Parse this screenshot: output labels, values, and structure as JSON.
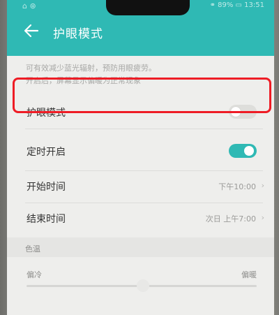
{
  "status": {
    "left": "⌂ ⊛",
    "right": "⚭ 89% ▭ 13:51"
  },
  "header": {
    "title": "护眼模式",
    "back_icon": "back-arrow-icon",
    "color": "#2fb9b4"
  },
  "description": {
    "line1": "可有效减少蓝光辐射，预防用眼疲劳。",
    "line2": "开启后，屏幕显示偏暖为正常现象"
  },
  "settings": {
    "eye_mode": {
      "label": "护眼模式",
      "enabled": false
    },
    "scheduled": {
      "label": "定时开启",
      "enabled": true
    },
    "start_time": {
      "label": "开始时间",
      "value": "下午10:00"
    },
    "end_time": {
      "label": "结束时间",
      "value": "次日 上午7:00"
    }
  },
  "color_temp": {
    "section_label": "色温",
    "cool_label": "偏冷",
    "warm_label": "偏暖"
  },
  "highlight_color": "#ee1c25"
}
